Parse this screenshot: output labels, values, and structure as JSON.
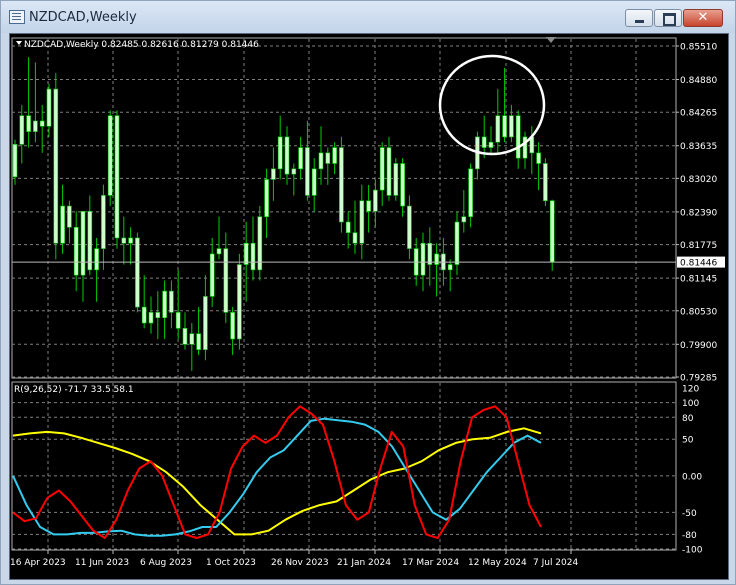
{
  "window": {
    "title": "NZDCAD,Weekly",
    "close_label": "✕"
  },
  "main_chart": {
    "header": "NZDCAD,Weekly  0.82485 0.82616 0.81279 0.81446",
    "symbol": "NZDCAD",
    "timeframe": "Weekly",
    "ohlc": {
      "open": 0.82485,
      "high": 0.82616,
      "low": 0.81279,
      "close": 0.81446
    },
    "price_levels": [
      "0.85510",
      "0.84880",
      "0.84265",
      "0.83635",
      "0.83020",
      "0.82390",
      "0.81775",
      "0.81145",
      "0.80530",
      "0.79900",
      "0.79285"
    ],
    "current_price_label": "0.81446",
    "colors": {
      "background": "#000000",
      "bull_candle": "#ccffcc",
      "wick": "#00cc00",
      "grid": "#7f7f7f",
      "annotation": "#ffffff"
    }
  },
  "indicator": {
    "header": "R(9,26,52) -71.7 33.5 58.1",
    "params": [
      9,
      26,
      52
    ],
    "values": {
      "fast": -71.7,
      "mid": 33.5,
      "slow": 58.1
    },
    "level_labels": [
      "120",
      "100",
      "80",
      "50",
      "0.00",
      "-50",
      "-80",
      "-100"
    ],
    "colors": {
      "fast": "#ff0000",
      "mid": "#33ccee",
      "slow": "#ffff00"
    }
  },
  "date_labels": [
    "16 Apr 2023",
    "11 Jun 2023",
    "6 Aug 2023",
    "1 Oct 2023",
    "26 Nov 2023",
    "21 Jan 2024",
    "17 Mar 2024",
    "12 May 2024",
    "7 Jul 2024"
  ],
  "chart_data": {
    "type": "candlestick",
    "timeframe": "weekly",
    "y_range": [
      0.79285,
      0.8551
    ],
    "candles": [
      {
        "o": 0.8305,
        "h": 0.8375,
        "l": 0.829,
        "c": 0.8366
      },
      {
        "o": 0.8366,
        "h": 0.844,
        "l": 0.833,
        "c": 0.842
      },
      {
        "o": 0.842,
        "h": 0.853,
        "l": 0.836,
        "c": 0.839
      },
      {
        "o": 0.839,
        "h": 0.852,
        "l": 0.837,
        "c": 0.841
      },
      {
        "o": 0.841,
        "h": 0.844,
        "l": 0.835,
        "c": 0.84
      },
      {
        "o": 0.84,
        "h": 0.848,
        "l": 0.838,
        "c": 0.847
      },
      {
        "o": 0.847,
        "h": 0.85,
        "l": 0.815,
        "c": 0.818
      },
      {
        "o": 0.818,
        "h": 0.829,
        "l": 0.816,
        "c": 0.825
      },
      {
        "o": 0.825,
        "h": 0.826,
        "l": 0.818,
        "c": 0.821
      },
      {
        "o": 0.821,
        "h": 0.824,
        "l": 0.809,
        "c": 0.812
      },
      {
        "o": 0.812,
        "h": 0.824,
        "l": 0.807,
        "c": 0.824
      },
      {
        "o": 0.824,
        "h": 0.827,
        "l": 0.812,
        "c": 0.813
      },
      {
        "o": 0.813,
        "h": 0.819,
        "l": 0.807,
        "c": 0.817
      },
      {
        "o": 0.817,
        "h": 0.829,
        "l": 0.813,
        "c": 0.827
      },
      {
        "o": 0.827,
        "h": 0.843,
        "l": 0.825,
        "c": 0.842
      },
      {
        "o": 0.842,
        "h": 0.843,
        "l": 0.817,
        "c": 0.819
      },
      {
        "o": 0.819,
        "h": 0.823,
        "l": 0.814,
        "c": 0.818
      },
      {
        "o": 0.818,
        "h": 0.821,
        "l": 0.814,
        "c": 0.819
      },
      {
        "o": 0.819,
        "h": 0.82,
        "l": 0.805,
        "c": 0.806
      },
      {
        "o": 0.806,
        "h": 0.812,
        "l": 0.802,
        "c": 0.803
      },
      {
        "o": 0.803,
        "h": 0.808,
        "l": 0.801,
        "c": 0.805
      },
      {
        "o": 0.805,
        "h": 0.809,
        "l": 0.8,
        "c": 0.804
      },
      {
        "o": 0.804,
        "h": 0.811,
        "l": 0.8,
        "c": 0.809
      },
      {
        "o": 0.809,
        "h": 0.811,
        "l": 0.802,
        "c": 0.805
      },
      {
        "o": 0.805,
        "h": 0.813,
        "l": 0.8,
        "c": 0.802
      },
      {
        "o": 0.802,
        "h": 0.805,
        "l": 0.798,
        "c": 0.799
      },
      {
        "o": 0.799,
        "h": 0.803,
        "l": 0.794,
        "c": 0.801
      },
      {
        "o": 0.801,
        "h": 0.806,
        "l": 0.797,
        "c": 0.798
      },
      {
        "o": 0.798,
        "h": 0.812,
        "l": 0.796,
        "c": 0.808
      },
      {
        "o": 0.808,
        "h": 0.819,
        "l": 0.806,
        "c": 0.816
      },
      {
        "o": 0.816,
        "h": 0.823,
        "l": 0.815,
        "c": 0.817
      },
      {
        "o": 0.817,
        "h": 0.82,
        "l": 0.803,
        "c": 0.805
      },
      {
        "o": 0.805,
        "h": 0.806,
        "l": 0.797,
        "c": 0.8
      },
      {
        "o": 0.8,
        "h": 0.816,
        "l": 0.798,
        "c": 0.814
      },
      {
        "o": 0.814,
        "h": 0.822,
        "l": 0.807,
        "c": 0.818
      },
      {
        "o": 0.818,
        "h": 0.823,
        "l": 0.811,
        "c": 0.813
      },
      {
        "o": 0.813,
        "h": 0.825,
        "l": 0.811,
        "c": 0.823
      },
      {
        "o": 0.823,
        "h": 0.832,
        "l": 0.819,
        "c": 0.83
      },
      {
        "o": 0.83,
        "h": 0.836,
        "l": 0.826,
        "c": 0.832
      },
      {
        "o": 0.832,
        "h": 0.842,
        "l": 0.83,
        "c": 0.838
      },
      {
        "o": 0.838,
        "h": 0.84,
        "l": 0.829,
        "c": 0.831
      },
      {
        "o": 0.831,
        "h": 0.833,
        "l": 0.827,
        "c": 0.832
      },
      {
        "o": 0.832,
        "h": 0.838,
        "l": 0.83,
        "c": 0.836
      },
      {
        "o": 0.836,
        "h": 0.841,
        "l": 0.826,
        "c": 0.827
      },
      {
        "o": 0.827,
        "h": 0.834,
        "l": 0.824,
        "c": 0.832
      },
      {
        "o": 0.832,
        "h": 0.84,
        "l": 0.829,
        "c": 0.835
      },
      {
        "o": 0.835,
        "h": 0.836,
        "l": 0.829,
        "c": 0.833
      },
      {
        "o": 0.833,
        "h": 0.837,
        "l": 0.831,
        "c": 0.836
      },
      {
        "o": 0.836,
        "h": 0.838,
        "l": 0.82,
        "c": 0.822
      },
      {
        "o": 0.822,
        "h": 0.824,
        "l": 0.817,
        "c": 0.82
      },
      {
        "o": 0.82,
        "h": 0.826,
        "l": 0.816,
        "c": 0.818
      },
      {
        "o": 0.818,
        "h": 0.829,
        "l": 0.815,
        "c": 0.826
      },
      {
        "o": 0.826,
        "h": 0.829,
        "l": 0.82,
        "c": 0.824
      },
      {
        "o": 0.824,
        "h": 0.83,
        "l": 0.821,
        "c": 0.828
      },
      {
        "o": 0.828,
        "h": 0.837,
        "l": 0.825,
        "c": 0.836
      },
      {
        "o": 0.836,
        "h": 0.838,
        "l": 0.826,
        "c": 0.827
      },
      {
        "o": 0.827,
        "h": 0.834,
        "l": 0.826,
        "c": 0.833
      },
      {
        "o": 0.833,
        "h": 0.834,
        "l": 0.823,
        "c": 0.825
      },
      {
        "o": 0.825,
        "h": 0.827,
        "l": 0.815,
        "c": 0.817
      },
      {
        "o": 0.817,
        "h": 0.819,
        "l": 0.81,
        "c": 0.812
      },
      {
        "o": 0.812,
        "h": 0.82,
        "l": 0.809,
        "c": 0.818
      },
      {
        "o": 0.818,
        "h": 0.821,
        "l": 0.81,
        "c": 0.814
      },
      {
        "o": 0.814,
        "h": 0.818,
        "l": 0.808,
        "c": 0.816
      },
      {
        "o": 0.816,
        "h": 0.819,
        "l": 0.81,
        "c": 0.813
      },
      {
        "o": 0.813,
        "h": 0.815,
        "l": 0.809,
        "c": 0.814
      },
      {
        "o": 0.814,
        "h": 0.824,
        "l": 0.812,
        "c": 0.822
      },
      {
        "o": 0.822,
        "h": 0.828,
        "l": 0.82,
        "c": 0.823
      },
      {
        "o": 0.823,
        "h": 0.833,
        "l": 0.821,
        "c": 0.832
      },
      {
        "o": 0.832,
        "h": 0.839,
        "l": 0.83,
        "c": 0.838
      },
      {
        "o": 0.838,
        "h": 0.842,
        "l": 0.834,
        "c": 0.836
      },
      {
        "o": 0.836,
        "h": 0.84,
        "l": 0.835,
        "c": 0.837
      },
      {
        "o": 0.837,
        "h": 0.847,
        "l": 0.835,
        "c": 0.842
      },
      {
        "o": 0.842,
        "h": 0.851,
        "l": 0.837,
        "c": 0.838
      },
      {
        "o": 0.838,
        "h": 0.844,
        "l": 0.837,
        "c": 0.842
      },
      {
        "o": 0.842,
        "h": 0.843,
        "l": 0.832,
        "c": 0.834
      },
      {
        "o": 0.834,
        "h": 0.839,
        "l": 0.832,
        "c": 0.838
      },
      {
        "o": 0.838,
        "h": 0.84,
        "l": 0.831,
        "c": 0.835
      },
      {
        "o": 0.835,
        "h": 0.837,
        "l": 0.828,
        "c": 0.833
      },
      {
        "o": 0.833,
        "h": 0.834,
        "l": 0.825,
        "c": 0.826
      },
      {
        "o": 0.826,
        "h": 0.8262,
        "l": 0.8128,
        "c": 0.8145
      }
    ],
    "indicator_series": {
      "name": "R(9,26,52)",
      "y_range": [
        -100,
        120
      ],
      "fast": [
        -50,
        -62,
        -58,
        -30,
        -20,
        -35,
        -55,
        -75,
        -85,
        -60,
        -20,
        10,
        20,
        0,
        -40,
        -80,
        -85,
        -80,
        -50,
        10,
        40,
        55,
        45,
        55,
        80,
        95,
        85,
        70,
        20,
        -40,
        -60,
        -50,
        10,
        60,
        40,
        -40,
        -80,
        -85,
        -60,
        20,
        80,
        90,
        95,
        80,
        20,
        -40,
        -70
      ],
      "mid": [
        0,
        -40,
        -70,
        -80,
        -80,
        -78,
        -78,
        -76,
        -75,
        -80,
        -82,
        -82,
        -80,
        -76,
        -70,
        -70,
        -50,
        -25,
        5,
        25,
        35,
        55,
        75,
        78,
        76,
        74,
        70,
        60,
        40,
        10,
        -20,
        -50,
        -60,
        -45,
        -20,
        5,
        25,
        45,
        55,
        45
      ],
      "slow": [
        55,
        58,
        60,
        58,
        52,
        45,
        38,
        30,
        20,
        5,
        -15,
        -40,
        -60,
        -80,
        -80,
        -75,
        -60,
        -48,
        -40,
        -35,
        -20,
        -5,
        5,
        10,
        20,
        35,
        45,
        50,
        52,
        60,
        65,
        58
      ]
    }
  }
}
